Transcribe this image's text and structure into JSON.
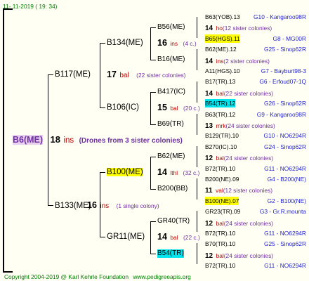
{
  "header": {
    "date": "11-  11-2019 (  19:  34)"
  },
  "root": {
    "id": "B6(ME)",
    "count": "18",
    "abbr": "ins",
    "note": "(Drones from 3 sister colonies)"
  },
  "gen1": [
    {
      "id": "B117(ME)",
      "count": "17",
      "abbr": "bal",
      "note": "(22 sister colonies)"
    },
    {
      "id": "B133(ME)",
      "count": "16",
      "abbr": "ins",
      "note": "(1 single colony)"
    }
  ],
  "gen2": [
    {
      "id": "B134(ME)",
      "count": "16",
      "abbr": "ins",
      "note": "(4 c.)"
    },
    {
      "id": "B106(IC)",
      "count": "15",
      "abbr": "bal",
      "note": "(20 c.)"
    },
    {
      "id": "B100(ME)",
      "count": "14",
      "abbr": "lthl",
      "note": "(32 c.)"
    },
    {
      "id": "GR11(ME)",
      "count": "14",
      "abbr": "bal",
      "note": "(22 c.)"
    }
  ],
  "gen3": [
    {
      "id": "B56(ME)"
    },
    {
      "id": "B16(ME)"
    },
    {
      "id": "B417(IC)"
    },
    {
      "id": "B69(TR)"
    },
    {
      "id": "B62(ME)"
    },
    {
      "id": "B200(BB)"
    },
    {
      "id": "GR40(TR)"
    },
    {
      "id": "B54(TR)"
    }
  ],
  "gen4": [
    {
      "id": "B63(YOB).13",
      "loc": "G10 - Kangaroo98R"
    },
    {
      "count": "14",
      "abbr": "ho",
      "note": "(12 sister colonies)"
    },
    {
      "id": "B65(HGS).11",
      "loc": "G8 - MG00R"
    },
    {
      "id": "B62(ME).12",
      "loc": "G25 - Sinop62R"
    },
    {
      "count": "14",
      "abbr": "ins",
      "note": "(2 sister colonies)"
    },
    {
      "id": "A11(HGS).10",
      "loc": "G7 - Bayburt98-3"
    },
    {
      "id": "B17(TR).13",
      "loc": "G6 - Erfoud07-1Q"
    },
    {
      "count": "14",
      "abbr": "bal",
      "note": "(22 sister colonies)"
    },
    {
      "id": "B54(TR).12",
      "loc": "G26 - Sinop62R"
    },
    {
      "id": "B63(TR).12",
      "loc": "G9 - Kangaroo98R"
    },
    {
      "count": "13",
      "abbr": "mrk",
      "note": "(24 sister colonies)"
    },
    {
      "id": "B129(TR).10",
      "loc": "G10 - NO6294R"
    },
    {
      "id": "B270(IC).10",
      "loc": "G24 - Sinop62R"
    },
    {
      "count": "12",
      "abbr": "bal",
      "note": "(24 sister colonies)"
    },
    {
      "id": "B72(TR).10",
      "loc": "G11 - NO6294R"
    },
    {
      "id": "B200(NE).09",
      "loc": "G4 - B200(NE)"
    },
    {
      "count": "11",
      "abbr": "val",
      "note": "(12 sister colonies)"
    },
    {
      "id": "B100(NE).07",
      "loc": "G2 - B100(NE)"
    },
    {
      "id": "GR23(TR).09",
      "loc": "G3 - Gr.R.mounta"
    },
    {
      "count": "12",
      "abbr": "bal",
      "note": "(24 sister colonies)"
    },
    {
      "id": "B72(TR).10",
      "loc": "G11 - NO6294R"
    },
    {
      "id": "B70(TR).10",
      "loc": "G25 - Sinop62R"
    },
    {
      "count": "12",
      "abbr": "bal",
      "note": "(24 sister colonies)"
    },
    {
      "id": "B72(TR).10",
      "loc": "G11 - NO6294R"
    }
  ],
  "footer": {
    "copyright": "Copyright 2004-2019 @ Karl Kehrle Foundation",
    "site": "www.pedigreeapis.org"
  },
  "colors": {
    "background": "#fffff4",
    "frame": "#000000",
    "highlight_yellow": "#ffff00",
    "highlight_cyan": "#00e5ee",
    "red": "#c00000",
    "blue": "#1f1fd0",
    "purple": "#7030a0",
    "green": "#008000"
  }
}
